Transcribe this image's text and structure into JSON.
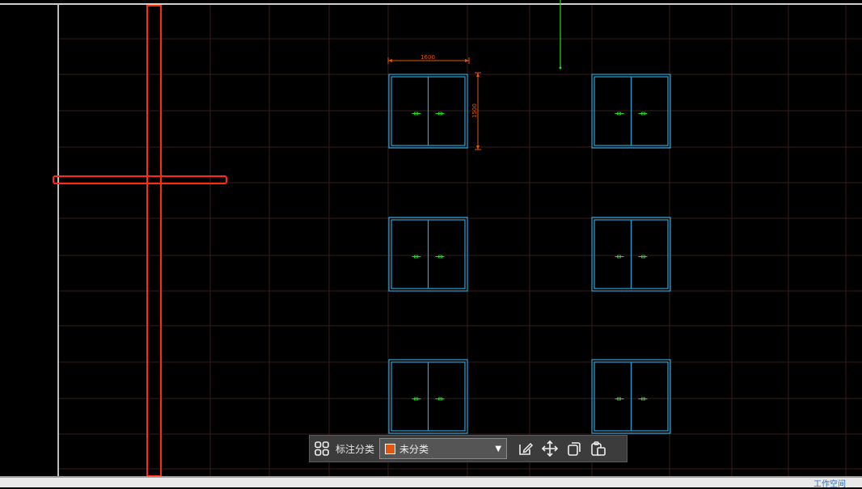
{
  "drawing": {
    "dim_width": "1600",
    "dim_height": "1500"
  },
  "toolbar": {
    "category_label": "标注分类",
    "category_value": "未分类",
    "swatch_color": "#e2560f",
    "icons": [
      "grid-icon",
      "edit-icon",
      "move-icon",
      "copy-icon",
      "paste-icon"
    ]
  },
  "colors": {
    "background": "#000000",
    "grid": "#3a1c1c",
    "window_frame": "#2aa5d8",
    "column_outline": "#ff2a14",
    "dimension": "#e2560f",
    "marker": "#22dd22"
  },
  "status": {
    "text": "工作空间"
  }
}
